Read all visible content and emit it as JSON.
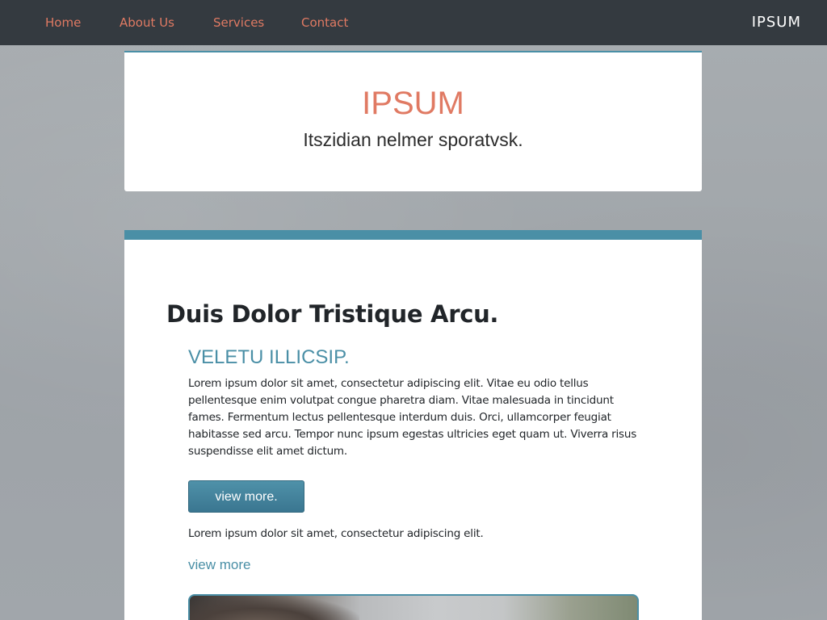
{
  "nav": {
    "links": [
      "Home",
      "About Us",
      "Services",
      "Contact"
    ],
    "brand": "IPSUM"
  },
  "header": {
    "title": "IPSUM",
    "tagline": "Itszidian nelmer sporatvsk."
  },
  "main": {
    "heading": "Duis Dolor Tristique Arcu.",
    "subheading": "VELETU ILLICSIP.",
    "paragraph": "Lorem ipsum dolor sit amet, consectetur adipiscing elit. Vitae eu odio tellus pellentesque enim volutpat congue pharetra diam. Vitae malesuada in tincidunt fames. Fermentum lectus pellentesque interdum duis. Orci, ullamcorper feugiat habitasse sed arcu. Tempor nunc ipsum egestas ultricies eget quam ut. Viverra risus suspendisse elit amet dictum.",
    "button_label": "view more.",
    "short_paragraph": "Lorem ipsum dolor sit amet, consectetur adipiscing elit.",
    "link_label": "view more"
  },
  "colors": {
    "nav_background": "#343a40",
    "nav_link": "#e07a63",
    "accent": "#4a8fa6",
    "title": "#e07a63",
    "text": "#212529"
  }
}
